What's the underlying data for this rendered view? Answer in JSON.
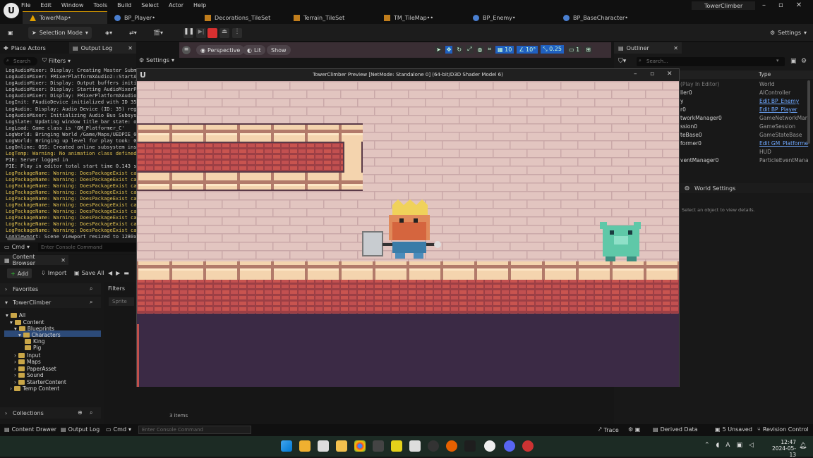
{
  "app": {
    "window_title": "TowerClimber",
    "logo": "U",
    "menu": [
      "File",
      "Edit",
      "Window",
      "Tools",
      "Build",
      "Select",
      "Actor",
      "Help"
    ],
    "tabs": [
      {
        "label": "TowerMap•",
        "active": true,
        "icon": "map-icon"
      },
      {
        "label": "BP_Player•",
        "icon": "blueprint-icon"
      },
      {
        "label": "Decorations_TileSet",
        "icon": "tileset-icon"
      },
      {
        "label": "Terrain_TileSet",
        "icon": "tileset-icon"
      },
      {
        "label": "TM_TileMap••",
        "icon": "tilemap-icon"
      },
      {
        "label": "BP_Enemy•",
        "icon": "blueprint-icon"
      },
      {
        "label": "BP_BaseCharacter•",
        "icon": "blueprint-icon"
      }
    ]
  },
  "toolbar": {
    "selection_mode": "Selection Mode",
    "settings": "Settings"
  },
  "viewport": {
    "perspective": "Perspective",
    "lit": "Lit",
    "show": "Show",
    "grid_value": "10",
    "angle_value": "10°",
    "scale_value": "0.25",
    "camera_speed": "1"
  },
  "left_panel": {
    "tab_place_actors": "Place Actors",
    "tab_output_log": "Output Log",
    "search_placeholder": "Search",
    "filters": "Filters",
    "settings": "Settings",
    "cmd_label": "Cmd",
    "cmd_placeholder": "Enter Console Command",
    "log_lines": [
      {
        "text": "LogAudioMixer: Display: Creating Master Subm",
        "warn": false
      },
      {
        "text": "LogAudioMixer: FMixerPlatformXAudio2::StartA",
        "warn": false
      },
      {
        "text": "LogAudioMixer: Display: Output buffers initi",
        "warn": false
      },
      {
        "text": "LogAudioMixer: Display: Starting AudioMixerP",
        "warn": false
      },
      {
        "text": "LogAudioMixer: Display: FMixerPlatformXAudio",
        "warn": false
      },
      {
        "text": "LogInit: FAudioDevice initialized with ID 35",
        "warn": false
      },
      {
        "text": "LogAudio: Display: Audio Device (ID: 35) reg",
        "warn": false
      },
      {
        "text": "LogAudioMixer: Initializing Audio Bus Subsys",
        "warn": false
      },
      {
        "text": "LogSlate: Updating window title bar state: o",
        "warn": false
      },
      {
        "text": "LogLoad: Game class is 'GM_Platformer_C'",
        "warn": false
      },
      {
        "text": "LogWorld: Bringing World /Game/Maps/UEDPIE_0",
        "warn": false
      },
      {
        "text": "LogWorld: Bringing up level for play took: 0",
        "warn": false
      },
      {
        "text": "LogOnline: OSS: Created online subsystem ins",
        "warn": false
      },
      {
        "text": "LogTemp: Warning: No animation class defined",
        "warn": true
      },
      {
        "text": "PIE: Server logged in",
        "warn": false
      },
      {
        "text": "PIE: Play in editor total start time 0.143 s",
        "warn": false
      },
      {
        "text": "LogPackageName: Warning: DoesPackageExist ca",
        "warn": true
      },
      {
        "text": "LogPackageName: Warning: DoesPackageExist ca",
        "warn": true
      },
      {
        "text": "LogPackageName: Warning: DoesPackageExist ca",
        "warn": true
      },
      {
        "text": "LogPackageName: Warning: DoesPackageExist ca",
        "warn": true
      },
      {
        "text": "LogPackageName: Warning: DoesPackageExist ca",
        "warn": true
      },
      {
        "text": "LogPackageName: Warning: DoesPackageExist ca",
        "warn": true
      },
      {
        "text": "LogPackageName: Warning: DoesPackageExist ca",
        "warn": true
      },
      {
        "text": "LogPackageName: Warning: DoesPackageExist ca",
        "warn": true
      },
      {
        "text": "LogPackageName: Warning: DoesPackageExist ca",
        "warn": true
      },
      {
        "text": "LogPackageName: Warning: DoesPackageExist ca",
        "warn": true
      },
      {
        "text": "LogViewport: Scene viewport resized to 1280x",
        "warn": false
      }
    ]
  },
  "content_browser": {
    "tab": "Content Browser",
    "add": "Add",
    "import": "Import",
    "save_all": "Save All",
    "favorites": "Favorites",
    "project": "TowerClimber",
    "filters": "Filters",
    "filter_chip": "Sprite",
    "item_count": "3 items",
    "collections": "Collections",
    "tree": [
      {
        "label": "All",
        "depth": 0
      },
      {
        "label": "Content",
        "depth": 1
      },
      {
        "label": "Blueprints",
        "depth": 2
      },
      {
        "label": "Characters",
        "depth": 3,
        "selected": true
      },
      {
        "label": "King",
        "depth": 4
      },
      {
        "label": "Pig",
        "depth": 4
      },
      {
        "label": "Input",
        "depth": 2
      },
      {
        "label": "Maps",
        "depth": 2
      },
      {
        "label": "PaperAsset",
        "depth": 2
      },
      {
        "label": "Sound",
        "depth": 2
      },
      {
        "label": "StarterContent",
        "depth": 2
      },
      {
        "label": "Temp Content",
        "depth": 1
      }
    ]
  },
  "game_window": {
    "title": "TowerClimber Preview [NetMode: Standalone 0]  (64-bit/D3D Shader Model 6)"
  },
  "outliner": {
    "tab": "Outliner",
    "search_placeholder": "Search...",
    "col_type": "Type",
    "rows": [
      {
        "name": "(Play In Editor)",
        "type": "World",
        "link": false
      },
      {
        "name": "ller0",
        "type": "AIController",
        "link": false
      },
      {
        "name": "y",
        "type": "Edit BP_Enemy",
        "link": true
      },
      {
        "name": "r0",
        "type": "Edit BP_Player",
        "link": true
      },
      {
        "name": "tworkManager0",
        "type": "GameNetworkMar",
        "link": false
      },
      {
        "name": "ssion0",
        "type": "GameSession",
        "link": false
      },
      {
        "name": "teBase0",
        "type": "GameStateBase",
        "link": false
      },
      {
        "name": "former0",
        "type": "Edit GM_Platforme",
        "link": true
      },
      {
        "name": "",
        "type": "HUD",
        "link": false
      },
      {
        "name": "ventManager0",
        "type": "ParticleEventMana",
        "link": false
      }
    ],
    "world_settings": "World Settings",
    "details_hint": "Select an object to view details."
  },
  "statusbar": {
    "content_drawer": "Content Drawer",
    "output_log": "Output Log",
    "cmd": "Cmd",
    "cmd_placeholder": "Enter Console Command",
    "trace": "Trace",
    "derived_data": "Derived Data",
    "unsaved": "5 Unsaved",
    "revision_control": "Revision Control"
  },
  "taskbar": {
    "time": "12:47",
    "date": "2024-05-13",
    "lang": "A"
  },
  "colors": {
    "accent": "#e0a000",
    "warn": "#e0c050",
    "link": "#6fa8ff",
    "brick": "#e2c5c0",
    "floor": "#f4d4ae",
    "wall_red": "#b5524e",
    "abyss": "#3b2a45"
  }
}
